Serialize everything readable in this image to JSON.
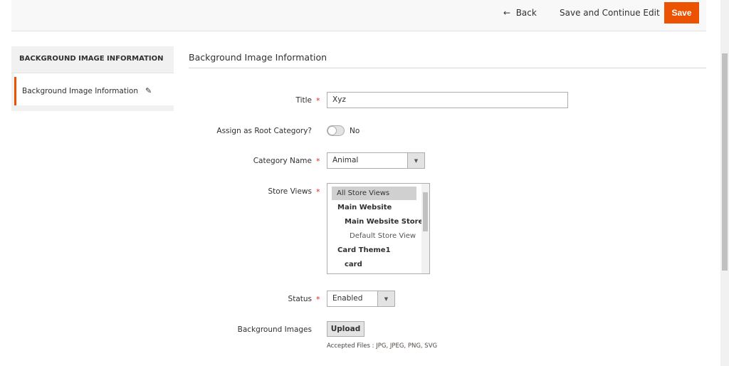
{
  "header": {
    "back_label": "Back",
    "back_icon": "arrow-left-icon",
    "save_continue_label": "Save and Continue Edit",
    "save_label": "Save",
    "accent": "#eb5202"
  },
  "sidebar": {
    "heading": "BACKGROUND IMAGE INFORMATION",
    "items": [
      {
        "label": "Background Image Information",
        "icon": "pencil-icon"
      }
    ]
  },
  "main": {
    "section_title": "Background Image Information",
    "fields": {
      "title": {
        "label": "Title",
        "value": "Xyz",
        "required": true
      },
      "root": {
        "label": "Assign as Root Category?",
        "value": "No"
      },
      "category": {
        "label": "Category Name",
        "value": "Animal",
        "required": true
      },
      "store_views": {
        "label": "Store Views",
        "required": true,
        "options": [
          "All Store Views",
          "Main Website",
          "Main Website Store",
          "Default Store View",
          "Card Theme1",
          "card"
        ],
        "selected": "All Store Views"
      },
      "status": {
        "label": "Status",
        "value": "Enabled",
        "required": true
      },
      "images": {
        "label": "Background Images",
        "button": "Upload",
        "note": "Accepted Files : ",
        "types": "JPG, JPEG, PNG, SVG"
      }
    },
    "required_mark": "*"
  }
}
